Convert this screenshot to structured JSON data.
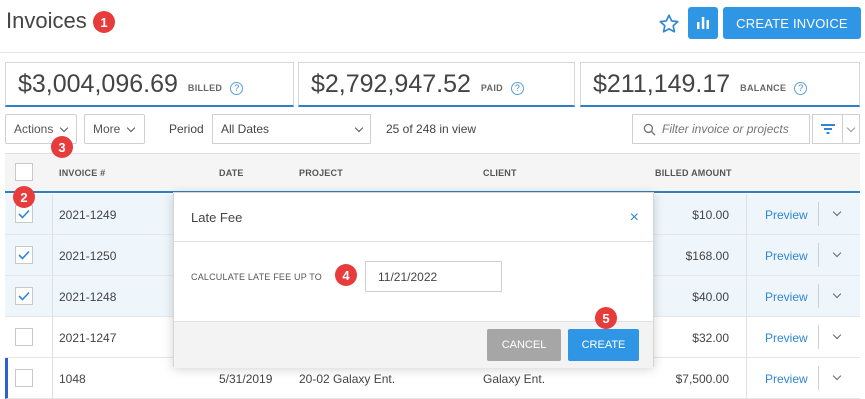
{
  "header": {
    "title": "Invoices",
    "create_label": "CREATE INVOICE",
    "star_icon": "star-icon",
    "chart_icon": "bar-chart-icon"
  },
  "markers": [
    "1",
    "2",
    "3",
    "4",
    "5"
  ],
  "totals": [
    {
      "amount": "$3,004,096.69",
      "label": "BILLED",
      "help": "?"
    },
    {
      "amount": "$2,792,947.52",
      "label": "PAID",
      "help": "?"
    },
    {
      "amount": "$211,149.17",
      "label": "BALANCE",
      "help": "?"
    }
  ],
  "toolbar": {
    "actions_label": "Actions",
    "more_label": "More",
    "period_label": "Period",
    "period_value": "All Dates",
    "view_count": "25 of 248 in view",
    "search_placeholder": "Filter invoice or projects"
  },
  "table": {
    "columns": {
      "invoice": "INVOICE #",
      "date": "DATE",
      "project": "PROJECT",
      "client": "CLIENT",
      "billed": "BILLED AMOUNT"
    },
    "preview_label": "Preview",
    "rows": [
      {
        "invoice": "2021-1249",
        "date": "",
        "project": "",
        "client": "",
        "amount": "$10.00",
        "checked": true
      },
      {
        "invoice": "2021-1250",
        "date": "",
        "project": "",
        "client": "",
        "amount": "$168.00",
        "checked": true
      },
      {
        "invoice": "2021-1248",
        "date": "",
        "project": "",
        "client": "",
        "amount": "$40.00",
        "checked": true
      },
      {
        "invoice": "2021-1247",
        "date": "",
        "project": "",
        "client": "",
        "amount": "$32.00",
        "checked": false
      },
      {
        "invoice": "1048",
        "date": "5/31/2019",
        "project": "20-02 Galaxy Ent.",
        "client": "Galaxy Ent.",
        "amount": "$7,500.00",
        "checked": false
      }
    ]
  },
  "modal": {
    "title": "Late Fee",
    "close": "×",
    "field_label": "CALCULATE LATE FEE UP TO",
    "field_value": "11/21/2022",
    "cancel_label": "CANCEL",
    "create_label": "CREATE"
  },
  "colors": {
    "accent": "#2f96e6",
    "marker": "#e83b3b",
    "selected_row": "#eef6fc"
  }
}
